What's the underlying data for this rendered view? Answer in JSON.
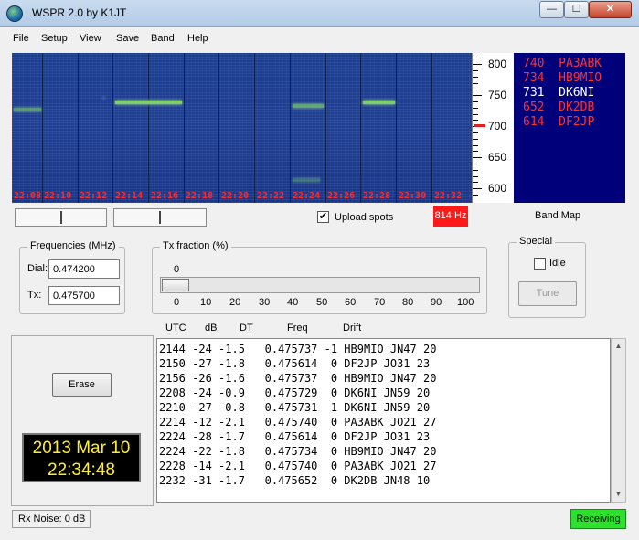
{
  "window": {
    "title": "WSPR 2.0    by K1JT",
    "min_glyph": "—",
    "max_glyph": "☐",
    "close_glyph": "✕"
  },
  "menu": [
    "File",
    "Setup",
    "View",
    "Save",
    "Band",
    "Help"
  ],
  "waterfall": {
    "time_labels": [
      "22:08",
      "22:10",
      "22:12",
      "22:14",
      "22:16",
      "22:18",
      "22:20",
      "22:22",
      "22:24",
      "22:26",
      "22:28",
      "22:30",
      "22:32"
    ],
    "freq_labels": [
      "800",
      "750",
      "700",
      "650",
      "600"
    ],
    "colors": {
      "background": "#213f8f",
      "signal": "#7ccf6a",
      "time_text": "#ff2a2a"
    }
  },
  "callsign_panel": [
    {
      "text": "740  PA3ABK",
      "color": "#ff3030"
    },
    {
      "text": "734  HB9MIO",
      "color": "#ff3030"
    },
    {
      "text": "731  DK6NI",
      "color": "#ffffff"
    },
    {
      "text": "652  DK2DB",
      "color": "#ff3030"
    },
    {
      "text": "614  DF2JP",
      "color": "#ff3030"
    }
  ],
  "upload_spots": {
    "label": "Upload spots",
    "checked": true,
    "check_glyph": "✔"
  },
  "audio_freq_box": "814 Hz",
  "band_map_label": "Band Map",
  "frequencies": {
    "title": "Frequencies (MHz)",
    "dial_label": "Dial:",
    "dial_value": "0.474200",
    "tx_label": "Tx:",
    "tx_value": "0.475700"
  },
  "tx_fraction": {
    "title": "Tx fraction (%)",
    "current": "0",
    "ticks": [
      "0",
      "10",
      "20",
      "30",
      "40",
      "50",
      "60",
      "70",
      "80",
      "90",
      "100"
    ]
  },
  "special": {
    "title": "Special",
    "idle_label": "Idle",
    "idle_checked": false,
    "tune_label": "Tune"
  },
  "columns": [
    "UTC",
    "dB",
    "DT",
    "Freq",
    "Drift"
  ],
  "erase_label": "Erase",
  "clock": {
    "date": "2013 Mar 10",
    "time": "22:34:48"
  },
  "decodes": [
    "2144 -24 -1.5   0.475737 -1 HB9MIO JN47 20",
    "2150 -27 -1.8   0.475614  0 DF2JP JO31 23",
    "2156 -26 -1.6   0.475737  0 HB9MIO JN47 20",
    "2208 -24 -0.9   0.475729  0 DK6NI JN59 20",
    "2210 -27 -0.8   0.475731  1 DK6NI JN59 20",
    "2214 -12 -2.1   0.475740  0 PA3ABK JO21 27",
    "2224 -28 -1.7   0.475614  0 DF2JP JO31 23",
    "2224 -22 -1.8   0.475734  0 HB9MIO JN47 20",
    "2228 -14 -2.1   0.475740  0 PA3ABK JO21 27",
    "2232 -31 -1.7   0.475652  0 DK2DB JN48 10"
  ],
  "status": {
    "rx_noise": "Rx Noise: 0 dB",
    "state": "Receiving",
    "state_color": "#2ee02e"
  }
}
